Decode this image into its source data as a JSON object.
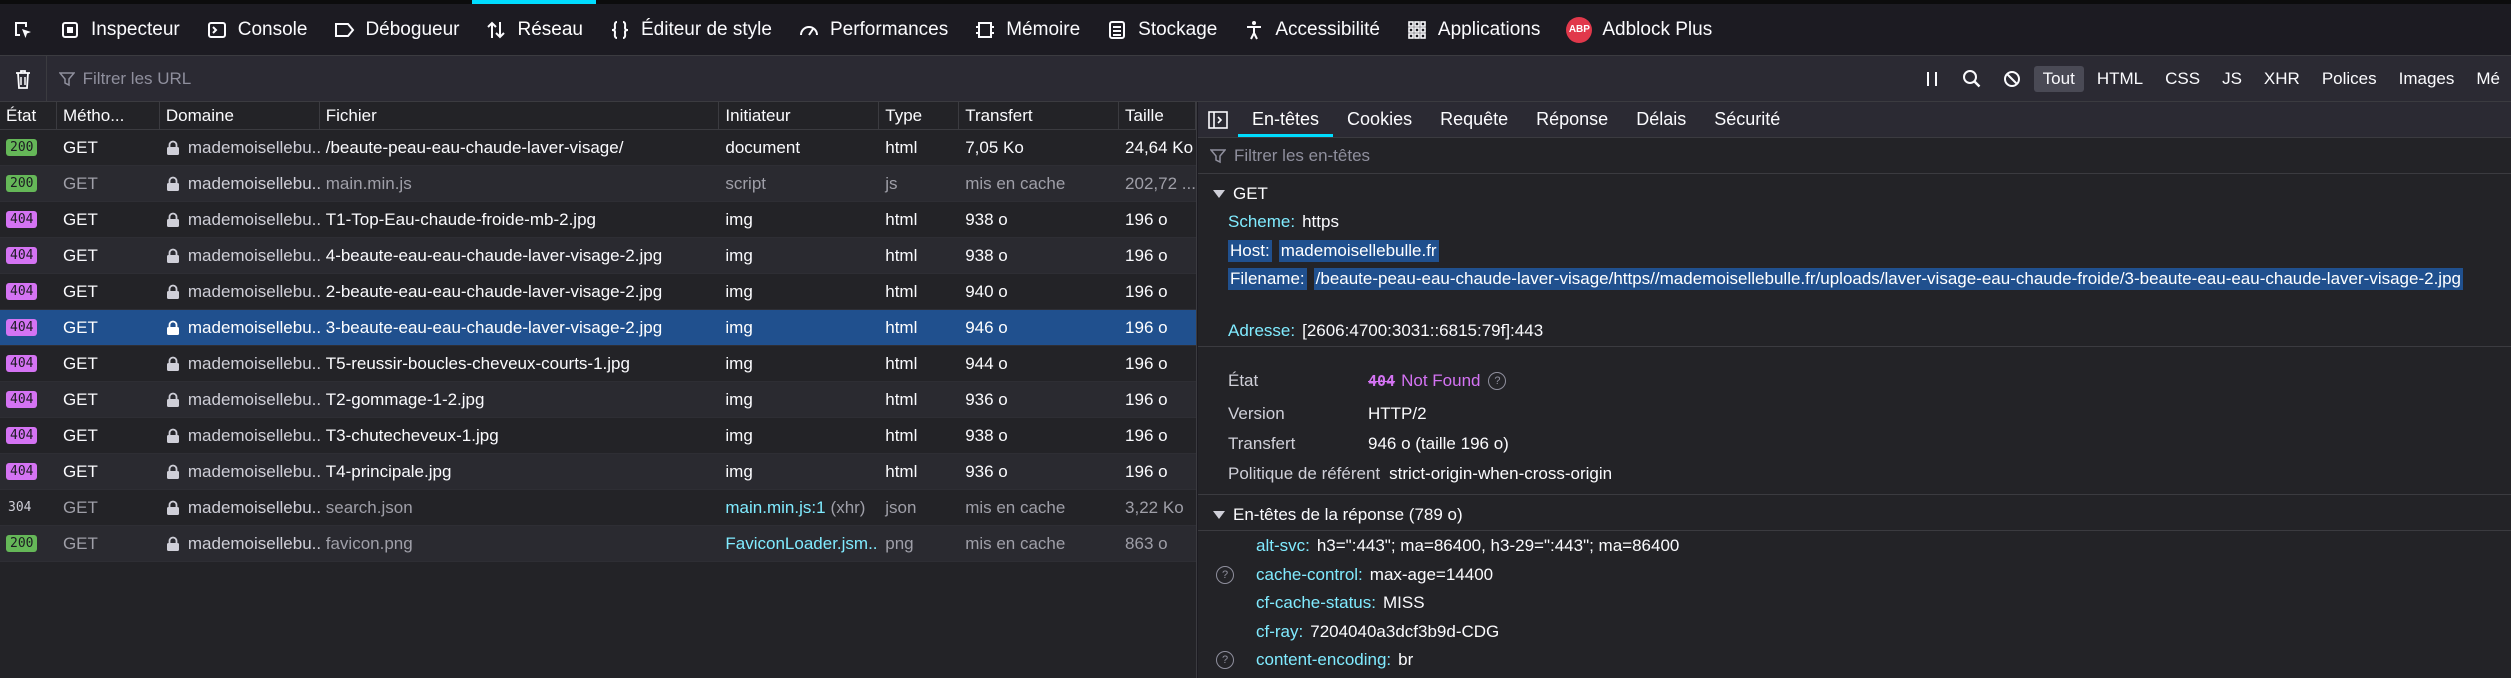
{
  "toolbox": {
    "tabs": [
      {
        "label": "Inspecteur",
        "icon": "inspector-icon"
      },
      {
        "label": "Console",
        "icon": "console-icon"
      },
      {
        "label": "Débogueur",
        "icon": "debugger-icon"
      },
      {
        "label": "Réseau",
        "icon": "network-icon",
        "active": true
      },
      {
        "label": "Éditeur de style",
        "icon": "style-editor-icon"
      },
      {
        "label": "Performances",
        "icon": "performance-icon"
      },
      {
        "label": "Mémoire",
        "icon": "memory-icon"
      },
      {
        "label": "Stockage",
        "icon": "storage-icon"
      },
      {
        "label": "Accessibilité",
        "icon": "accessibility-icon"
      },
      {
        "label": "Applications",
        "icon": "applications-icon"
      },
      {
        "label": "Adblock Plus",
        "icon": "adblock-plus-icon"
      }
    ],
    "abp_text": "ABP"
  },
  "filterbar": {
    "url_placeholder": "Filtrer les URL",
    "types": [
      "Tout",
      "HTML",
      "CSS",
      "JS",
      "XHR",
      "Polices",
      "Images",
      "Mé"
    ],
    "active_type": "Tout"
  },
  "table": {
    "headers": [
      "État",
      "Métho...",
      "Domaine",
      "Fichier",
      "Initiateur",
      "Type",
      "Transfert",
      "Taille"
    ],
    "rows": [
      {
        "status": "200",
        "method": "GET",
        "domain": "mademoisellebu...",
        "file": "/beaute-peau-eau-chaude-laver-visage/",
        "initiator": "document",
        "initiator_extra": "",
        "type": "html",
        "transfer": "7,05 Ko",
        "size": "24,64 Ko"
      },
      {
        "status": "200",
        "method": "GET",
        "domain": "mademoisellebu...",
        "file": "main.min.js",
        "initiator": "script",
        "initiator_extra": "",
        "type": "js",
        "transfer": "mis en cache",
        "size": "202,72 ..."
      },
      {
        "status": "404",
        "method": "GET",
        "domain": "mademoisellebu...",
        "file": "T1-Top-Eau-chaude-froide-mb-2.jpg",
        "initiator": "img",
        "initiator_extra": "",
        "type": "html",
        "transfer": "938 o",
        "size": "196 o"
      },
      {
        "status": "404",
        "method": "GET",
        "domain": "mademoisellebu...",
        "file": "4-beaute-eau-eau-chaude-laver-visage-2.jpg",
        "initiator": "img",
        "initiator_extra": "",
        "type": "html",
        "transfer": "938 o",
        "size": "196 o"
      },
      {
        "status": "404",
        "method": "GET",
        "domain": "mademoisellebu...",
        "file": "2-beaute-eau-eau-chaude-laver-visage-2.jpg",
        "initiator": "img",
        "initiator_extra": "",
        "type": "html",
        "transfer": "940 o",
        "size": "196 o"
      },
      {
        "status": "404",
        "method": "GET",
        "domain": "mademoisellebu...",
        "file": "3-beaute-eau-eau-chaude-laver-visage-2.jpg",
        "initiator": "img",
        "initiator_extra": "",
        "type": "html",
        "transfer": "946 o",
        "size": "196 o"
      },
      {
        "status": "404",
        "method": "GET",
        "domain": "mademoisellebu...",
        "file": "T5-reussir-boucles-cheveux-courts-1.jpg",
        "initiator": "img",
        "initiator_extra": "",
        "type": "html",
        "transfer": "944 o",
        "size": "196 o"
      },
      {
        "status": "404",
        "method": "GET",
        "domain": "mademoisellebu...",
        "file": "T2-gommage-1-2.jpg",
        "initiator": "img",
        "initiator_extra": "",
        "type": "html",
        "transfer": "936 o",
        "size": "196 o"
      },
      {
        "status": "404",
        "method": "GET",
        "domain": "mademoisellebu...",
        "file": "T3-chutecheveux-1.jpg",
        "initiator": "img",
        "initiator_extra": "",
        "type": "html",
        "transfer": "938 o",
        "size": "196 o"
      },
      {
        "status": "404",
        "method": "GET",
        "domain": "mademoisellebu...",
        "file": "T4-principale.jpg",
        "initiator": "img",
        "initiator_extra": "",
        "type": "html",
        "transfer": "936 o",
        "size": "196 o"
      },
      {
        "status": "304",
        "method": "GET",
        "domain": "mademoisellebu...",
        "file": "search.json",
        "initiator": "main.min.js:1",
        "initiator_extra": "(xhr)",
        "type": "json",
        "transfer": "mis en cache",
        "size": "3,22 Ko"
      },
      {
        "status": "200",
        "method": "GET",
        "domain": "mademoisellebu...",
        "file": "favicon.png",
        "initiator": "FaviconLoader.jsm...",
        "initiator_extra": "",
        "type": "png",
        "transfer": "mis en cache",
        "size": "863 o"
      }
    ]
  },
  "details": {
    "tabs": [
      "En-têtes",
      "Cookies",
      "Requête",
      "Réponse",
      "Délais",
      "Sécurité"
    ],
    "active_tab": "En-têtes",
    "filter_placeholder": "Filtrer les en-têtes",
    "request_section": "GET",
    "scheme_key": "Scheme:",
    "scheme_val": "https",
    "host_key": "Host:",
    "host_val": "mademoisellebulle.fr",
    "filename_key": "Filename:",
    "filename_val": "/beaute-peau-eau-chaude-laver-visage/https//mademoisellebulle.fr/uploads/laver-visage-eau-chaude-froide/3-beaute-eau-eau-chaude-laver-visage-2.jpg",
    "address_key": "Adresse:",
    "address_val": "[2606:4700:3031::6815:79f]:443",
    "status_label": "État",
    "status_code": "404",
    "status_text": "Not Found",
    "version_label": "Version",
    "version_val": "HTTP/2",
    "transfer_label": "Transfert",
    "transfer_val": "946 o (taille 196 o)",
    "referrer_label": "Politique de référent",
    "referrer_val": "strict-origin-when-cross-origin",
    "response_section": "En-têtes de la réponse (789 o)",
    "response_headers": [
      {
        "key": "alt-svc:",
        "val": "h3=\":443\"; ma=86400, h3-29=\":443\"; ma=86400",
        "help": false
      },
      {
        "key": "cache-control:",
        "val": "max-age=14400",
        "help": true
      },
      {
        "key": "cf-cache-status:",
        "val": "MISS",
        "help": false
      },
      {
        "key": "cf-ray:",
        "val": "7204040a3dcf3b9d-CDG",
        "help": false
      },
      {
        "key": "content-encoding:",
        "val": "br",
        "help": true
      }
    ]
  }
}
